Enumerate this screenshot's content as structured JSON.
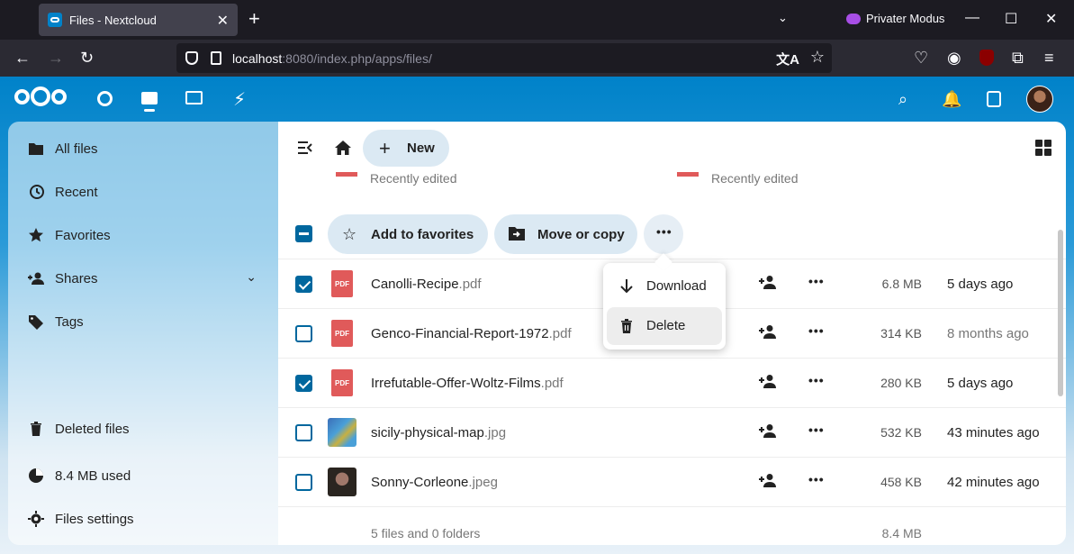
{
  "browser": {
    "tab_title": "Files - Nextcloud",
    "tab_close": "✕",
    "new_tab": "+",
    "tab_list": "⌄",
    "private_label": "Privater Modus",
    "url_host": "localhost",
    "url_path": ":8080/index.php/apps/files/",
    "translate": "文A",
    "bookmark": "☆"
  },
  "sidebar": {
    "items": [
      {
        "label": "All files"
      },
      {
        "label": "Recent"
      },
      {
        "label": "Favorites"
      },
      {
        "label": "Shares",
        "chevron": "⌄"
      },
      {
        "label": "Tags"
      }
    ],
    "bottom": [
      {
        "label": "Deleted files"
      },
      {
        "label": "8.4 MB used"
      },
      {
        "label": "Files settings"
      }
    ]
  },
  "toolbar": {
    "new_label": "New",
    "plus": "+"
  },
  "recent": [
    {
      "label": "Recently edited"
    },
    {
      "label": "Recently edited"
    }
  ],
  "actions": {
    "favorites_label": "Add to favorites",
    "move_label": "Move or copy",
    "more": "•••"
  },
  "menu": {
    "download": "Download",
    "delete": "Delete"
  },
  "files": [
    {
      "base": "Canolli-Recipe",
      "ext": ".pdf",
      "size": "6.8 MB",
      "mtime": "5 days ago",
      "checked": true,
      "thumb": "pdf"
    },
    {
      "base": "Genco-Financial-Report-1972",
      "ext": ".pdf",
      "size": "314 KB",
      "mtime": "8 months ago",
      "checked": false,
      "thumb": "pdf"
    },
    {
      "base": "Irrefutable-Offer-Woltz-Films",
      "ext": ".pdf",
      "size": "280 KB",
      "mtime": "5 days ago",
      "checked": true,
      "thumb": "pdf"
    },
    {
      "base": "sicily-physical-map",
      "ext": ".jpg",
      "size": "532 KB",
      "mtime": "43 minutes ago",
      "checked": false,
      "thumb": "map"
    },
    {
      "base": "Sonny-Corleone",
      "ext": ".jpeg",
      "size": "458 KB",
      "mtime": "42 minutes ago",
      "checked": false,
      "thumb": "photo"
    }
  ],
  "pdf_badge": "PDF",
  "row_actions": {
    "share": "👤+",
    "menu": "•••"
  },
  "summary": {
    "count": "5 files and 0 folders",
    "total": "8.4 MB"
  },
  "colors": {
    "primary": "#0082c9",
    "button_bg": "#dbe9f3",
    "checkbox": "#00679e",
    "pdf_red": "#e05a5a"
  }
}
